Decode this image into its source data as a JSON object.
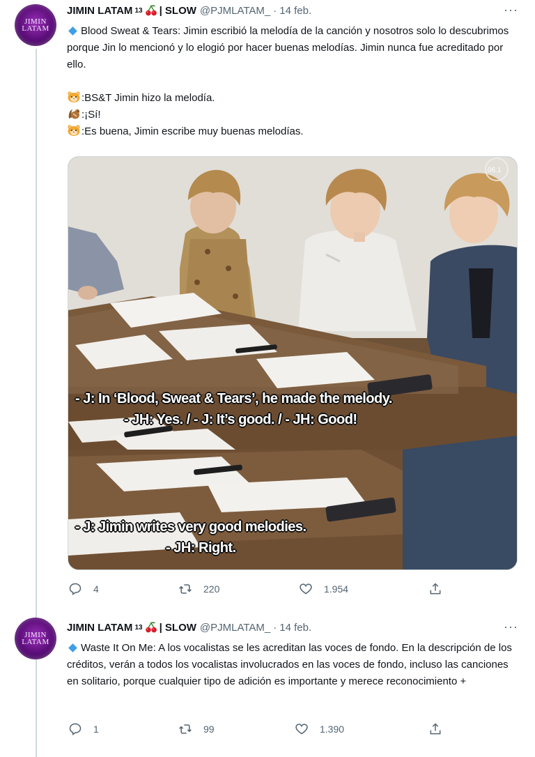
{
  "tweets": [
    {
      "avatar_text": [
        "JIMIN",
        "LATAM"
      ],
      "name": "JIMIN LATAM",
      "superscript": "13",
      "name_suffix": "| SLOW",
      "handle": "@PJMLATAM_",
      "separator": "·",
      "date": "14 feb.",
      "more": "···",
      "text": "Blood Sweat & Tears: Jimin escribió la melodía de la canción y nosotros solo lo descubrimos porque Jin lo mencionó y lo elogió por hacer buenas melodías. Jimin nunca fue acreditado por ello.",
      "dialogue": [
        {
          "icon": "hamster-emoji",
          "text": ":BS&T Jimin hizo la melodía."
        },
        {
          "icon": "chipmunk-emoji",
          "text": ":¡Sí!"
        },
        {
          "icon": "hamster-emoji",
          "text": ":Es buena, Jimin escribe muy buenas melodías."
        }
      ],
      "media": {
        "watermark": "06.1",
        "captions": [
          "- J: In ‘Blood, Sweat & Tears’, he made the melody.",
          "- JH: Yes. / - J: It’s good. / - JH: Good!",
          "- J: Jimin writes very good melodies.",
          "- JH: Right."
        ]
      },
      "replies": "4",
      "retweets": "220",
      "likes": "1.954"
    },
    {
      "avatar_text": [
        "JIMIN",
        "LATAM"
      ],
      "name": "JIMIN LATAM",
      "superscript": "13",
      "name_suffix": "| SLOW",
      "handle": "@PJMLATAM_",
      "separator": "·",
      "date": "14 feb.",
      "more": "···",
      "text": "Waste It On Me: A los vocalistas se les acreditan las voces de fondo. En la descripción de los créditos, verán a todos los vocalistas involucrados en las voces de fondo, incluso las canciones en solitario, porque cualquier tipo de adición es importante y merece reconocimiento +",
      "replies": "1",
      "retweets": "99",
      "likes": "1.390"
    }
  ],
  "colors": {
    "accent": "#1d9bf0",
    "muted": "#536471",
    "text": "#0f1419",
    "thread_line": "#cfd9de",
    "cherry": "#d91c2b",
    "leaf": "#3c8a2e"
  }
}
